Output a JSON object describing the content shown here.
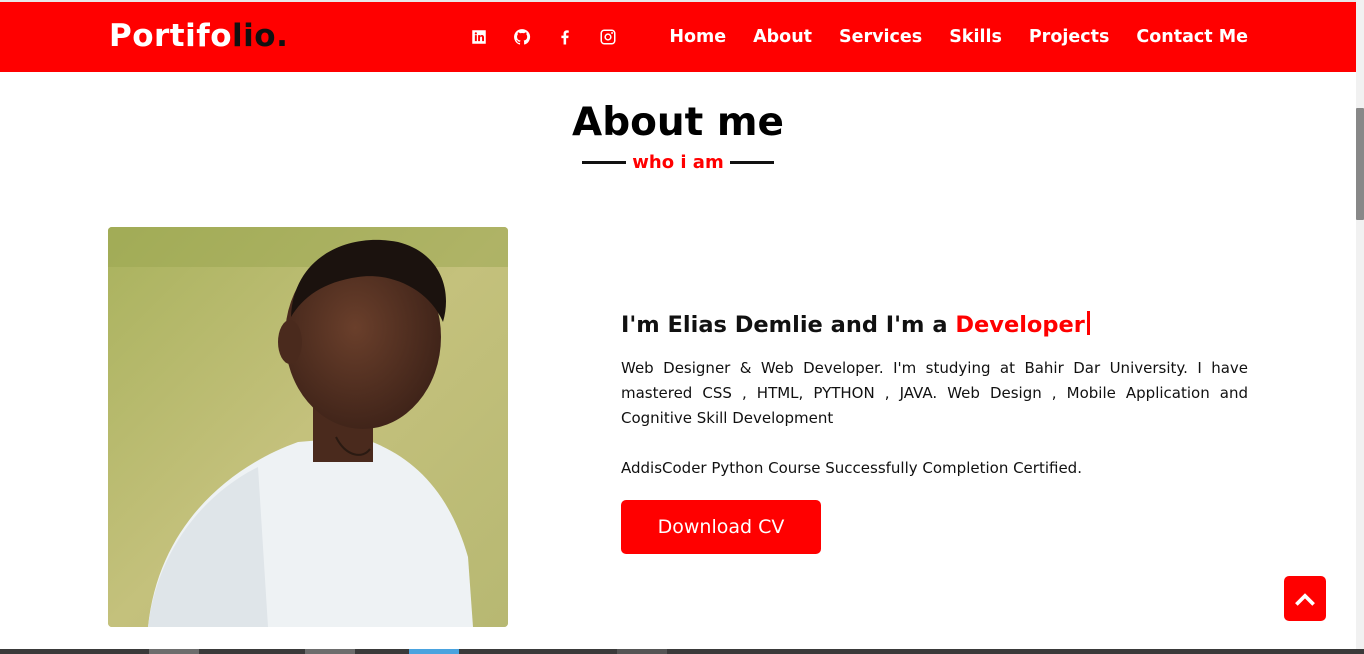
{
  "brand": {
    "logo_main": "Portifo",
    "logo_accent": "lio."
  },
  "nav": {
    "social": [
      "linkedin-icon",
      "github-icon",
      "facebook-icon",
      "instagram-icon"
    ],
    "links": [
      "Home",
      "About",
      "Services",
      "Skills",
      "Projects",
      "Contact Me"
    ]
  },
  "section": {
    "title": "About me",
    "subtitle": "who i am"
  },
  "about": {
    "intro_prefix": "I'm Elias Demlie and I'm a ",
    "role": "Developer",
    "bio": "Web Designer & Web Developer. I'm studying at Bahir Dar University. I have mastered CSS , HTML, PYTHON , JAVA. Web Design , Mobile Application and Cognitive Skill Development",
    "certification": "AddisCoder Python Course Successfully Completion Certified.",
    "cv_button": "Download CV"
  },
  "colors": {
    "accent": "#ff0000",
    "text": "#111111",
    "background": "#ffffff"
  },
  "icons": {
    "scroll_top": "chevron-up-icon"
  }
}
